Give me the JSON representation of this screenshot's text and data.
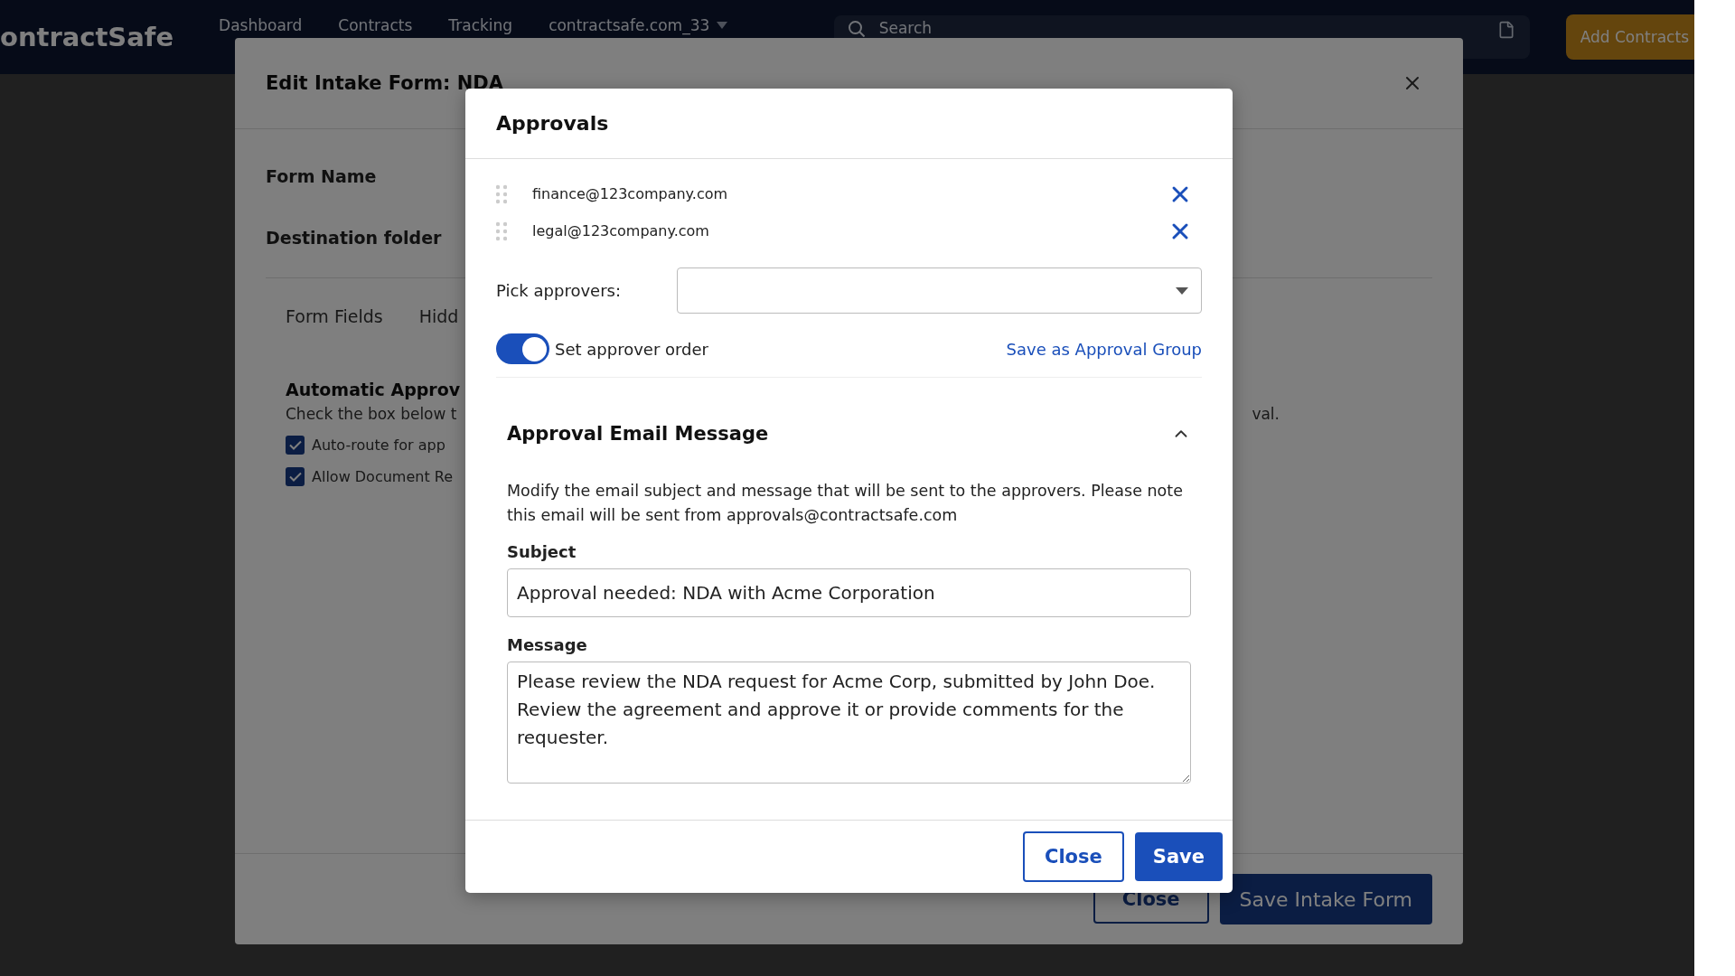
{
  "navbar": {
    "logo": "ontractSafe",
    "links": [
      "Dashboard",
      "Contracts",
      "Tracking"
    ],
    "account": "contractsafe.com_33",
    "search": {
      "placeholder": "Search"
    },
    "add_button": "Add Contracts"
  },
  "intake_form": {
    "title": "Edit Intake Form: NDA",
    "fields": [
      "Form Name",
      "Destination folder"
    ],
    "tabs": [
      "Form Fields",
      "Hidd"
    ],
    "section_title": "Automatic Approv",
    "section_text": "Check the box below t",
    "section_text_end": "val.",
    "checkboxes": [
      {
        "label": "Auto-route for app",
        "checked": true
      },
      {
        "label": "Allow Document Re",
        "checked": true
      }
    ],
    "buttons": {
      "close": "Close",
      "save": "Save Intake Form"
    }
  },
  "approvals": {
    "title": "Approvals",
    "approvers": [
      "finance@123company.com",
      "legal@123company.com"
    ],
    "pick_label": "Pick approvers:",
    "order_toggle": {
      "label": "Set approver order",
      "on": true
    },
    "save_group_link": "Save as Approval Group",
    "email": {
      "title": "Approval Email Message",
      "expanded": true,
      "description": "Modify the email subject and message that will be sent to the approvers. Please note this email will be sent from approvals@contractsafe.com",
      "subject_label": "Subject",
      "subject": "Approval needed: NDA with Acme Corporation",
      "message_label": "Message",
      "message": "Please review the NDA request for Acme Corp, submitted by John Doe. Review the agreement and approve it or provide comments for the requester."
    },
    "buttons": {
      "close": "Close",
      "save": "Save"
    }
  }
}
